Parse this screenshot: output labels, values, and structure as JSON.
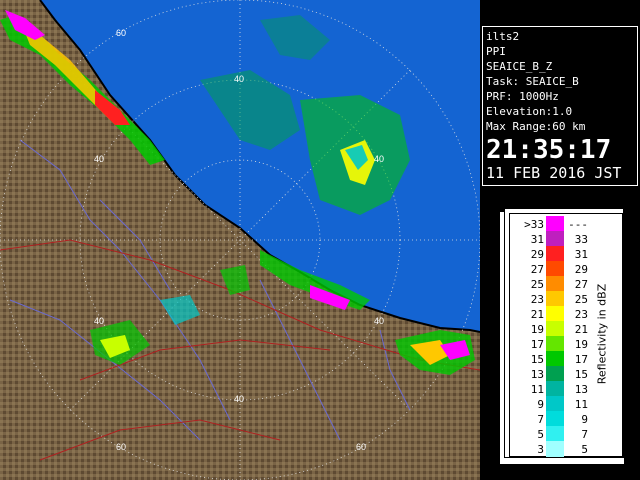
{
  "info": {
    "station": "ilts2",
    "product": "PPI",
    "scan": "SEAICE_B_Z",
    "task": "Task: SEAICE_B",
    "prf": "PRF: 1000Hz",
    "elevation": "Elevation:1.0",
    "max_range": "Max Range:60 km",
    "time": "21:35:17",
    "date": "11 FEB 2016 JST"
  },
  "range_labels": [
    "60",
    "40",
    "40",
    "40",
    "40",
    "40",
    "60",
    "60"
  ],
  "legend": {
    "unit": "Reflectivity in dBZ",
    "rows": [
      {
        "lo": ">33",
        "hi": "---",
        "color": "#ff00ff"
      },
      {
        "lo": "31",
        "hi": "33",
        "color": "#bf1fbf"
      },
      {
        "lo": "29",
        "hi": "31",
        "color": "#ff2020"
      },
      {
        "lo": "27",
        "hi": "29",
        "color": "#ff4a00"
      },
      {
        "lo": "25",
        "hi": "27",
        "color": "#ff8c00"
      },
      {
        "lo": "23",
        "hi": "25",
        "color": "#ffc800"
      },
      {
        "lo": "21",
        "hi": "23",
        "color": "#ffff00"
      },
      {
        "lo": "19",
        "hi": "21",
        "color": "#c8ff00"
      },
      {
        "lo": "17",
        "hi": "19",
        "color": "#64e600"
      },
      {
        "lo": "15",
        "hi": "17",
        "color": "#00c800"
      },
      {
        "lo": "13",
        "hi": "15",
        "color": "#00a050"
      },
      {
        "lo": "11",
        "hi": "13",
        "color": "#00b4a0"
      },
      {
        "lo": "9",
        "hi": "11",
        "color": "#00c8c8"
      },
      {
        "lo": "7",
        "hi": "9",
        "color": "#00dcdc"
      },
      {
        "lo": "5",
        "hi": "7",
        "color": "#30f0f0"
      },
      {
        "lo": "3",
        "hi": "5",
        "color": "#a0ffff"
      }
    ]
  },
  "colors": {
    "sea": "#1464d2",
    "land": "#7a6446",
    "land_dark": "#5a4630",
    "rings": "#e0e0e0",
    "coast": "#000000",
    "rivers": "#6a6ad0",
    "roads": "#b02020"
  }
}
